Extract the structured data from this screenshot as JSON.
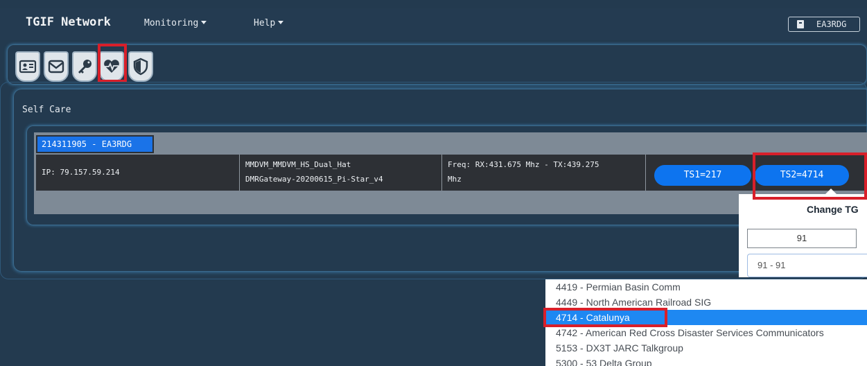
{
  "navbar": {
    "brand": "TGIF Network",
    "menu": [
      {
        "label": "Monitoring"
      },
      {
        "label": "Help"
      }
    ],
    "user_label": "EA3RDG"
  },
  "tabs": [
    {
      "icon": "contact-card-icon"
    },
    {
      "icon": "envelope-icon"
    },
    {
      "icon": "key-icon"
    },
    {
      "icon": "heartbeat-icon",
      "highlighted": true
    },
    {
      "icon": "shield-icon"
    }
  ],
  "panel": {
    "title": "Self Care",
    "device": {
      "tag": "214311905 - EA3RDG",
      "ip": "IP: 79.157.59.214",
      "software_line1": "MMDVM_MMDVM_HS_Dual_Hat",
      "software_line2": "DMRGateway-20200615_Pi-Star_v4",
      "freq_line1": "Freq: RX:431.675 Mhz - TX:439.275",
      "freq_line2": "Mhz",
      "ts1_label": "TS1=217",
      "ts2_label": "TS2=4714"
    }
  },
  "change_tg": {
    "title": "Change TG",
    "input_value": "91",
    "selected_value": "91 - 91",
    "options": [
      {
        "label": "4419 - Permian Basin Comm"
      },
      {
        "label": "4449 - North American Railroad SIG"
      },
      {
        "label": "4714 - Catalunya",
        "selected": true
      },
      {
        "label": "4742 - American Red Cross Disaster Services Communicators"
      },
      {
        "label": "5153 - DX3T JARC Talkgroup"
      },
      {
        "label": "5300 - 53 Delta Group"
      }
    ]
  },
  "colors": {
    "background": "#233a4f",
    "accent": "#0d74ef",
    "highlight": "#d81f2a"
  }
}
